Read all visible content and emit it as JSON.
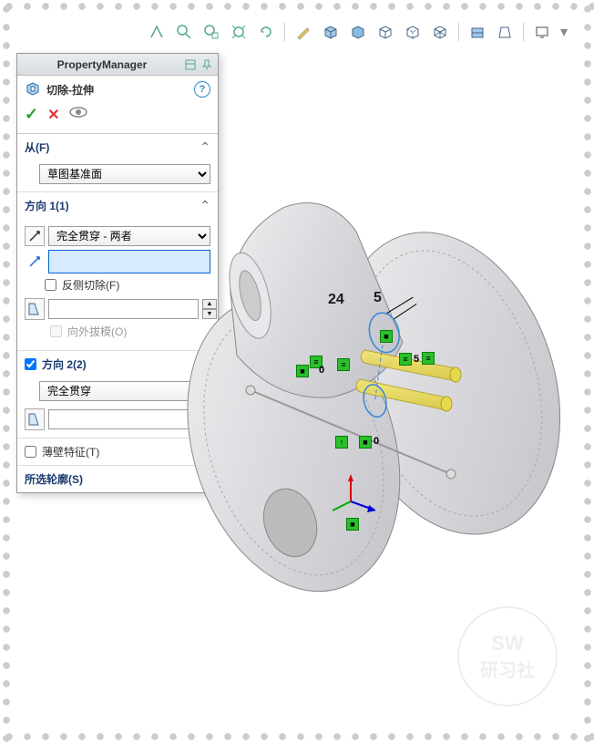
{
  "toolbar": {
    "icons": [
      "view-icon",
      "zoom-icon",
      "zoom-area-icon",
      "zoom-fit-icon",
      "rotate-icon",
      "pan-icon",
      "sketch-icon",
      "shaded-icon",
      "wireframe-icon",
      "hidden-icon",
      "section-icon",
      "perspective-icon",
      "appearance-icon",
      "display-icon",
      "screen-icon"
    ]
  },
  "pm": {
    "title": "PropertyManager",
    "feature_name": "切除-拉伸",
    "help": "?",
    "sections": {
      "from": {
        "label": "从(F)",
        "start_condition": "草图基准面"
      },
      "dir1": {
        "label": "方向 1(1)",
        "end_condition": "完全贯穿 - 两者",
        "flip_side": "反侧切除(F)",
        "draft_outward": "向外拔模(O)"
      },
      "dir2": {
        "label": "方向 2(2)",
        "checked": true,
        "end_condition": "完全贯穿"
      },
      "thin": {
        "label": "薄壁特征(T)",
        "checked": false
      },
      "contours": {
        "label": "所选轮廓(S)"
      }
    }
  },
  "viewport": {
    "dimensions": {
      "d1": "24",
      "d2": "5"
    },
    "constraint_labels": [
      "5",
      "0",
      "5",
      "0"
    ]
  },
  "watermark": {
    "line1": "SW",
    "line2": "研习社"
  }
}
